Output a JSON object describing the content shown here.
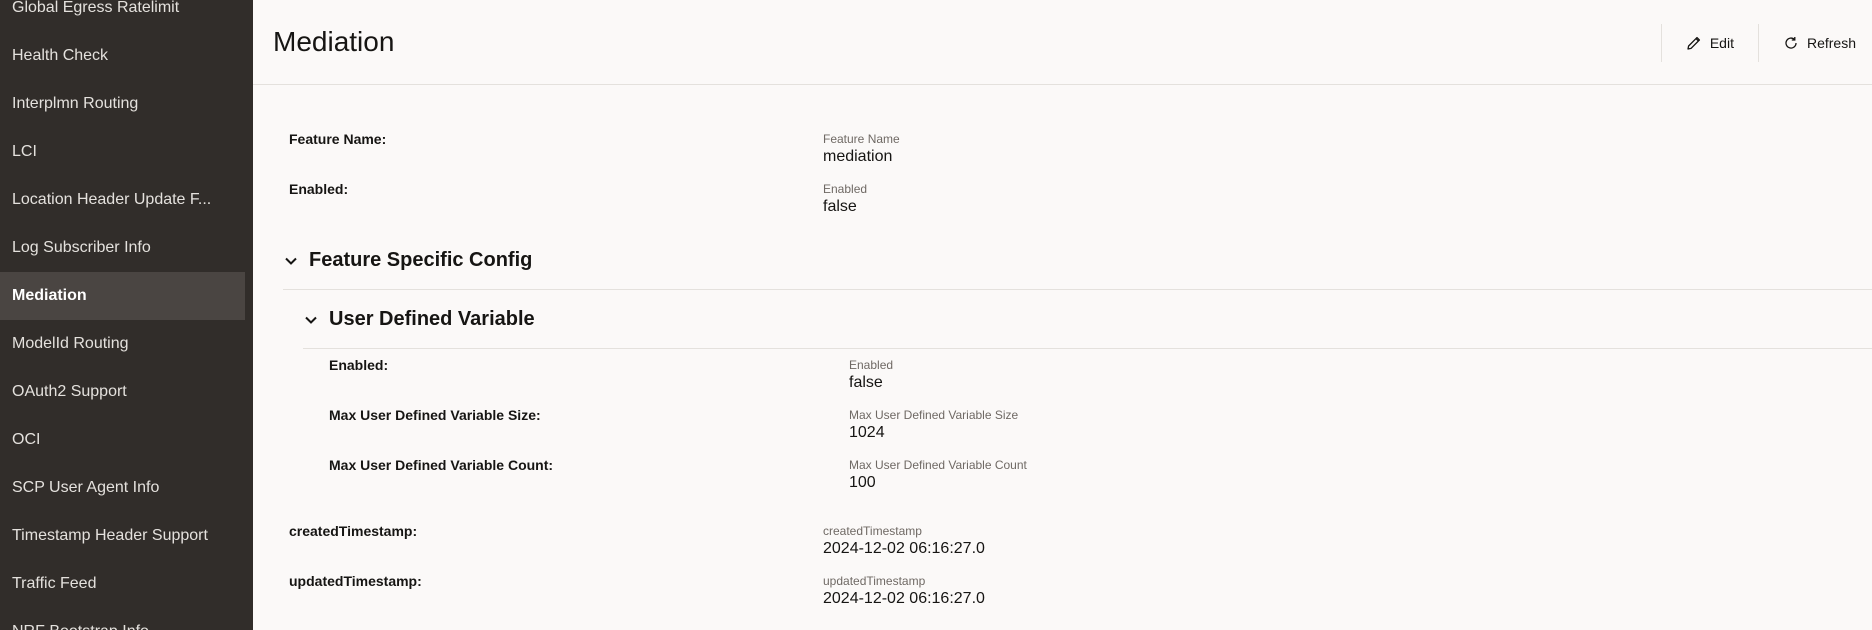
{
  "sidebar": {
    "items": [
      {
        "label": "Global Egress Ratelimit"
      },
      {
        "label": "Health Check"
      },
      {
        "label": "Interplmn Routing"
      },
      {
        "label": "LCI"
      },
      {
        "label": "Location Header Update F..."
      },
      {
        "label": "Log Subscriber Info"
      },
      {
        "label": "Mediation"
      },
      {
        "label": "ModelId Routing"
      },
      {
        "label": "OAuth2 Support"
      },
      {
        "label": "OCI"
      },
      {
        "label": "SCP User Agent Info"
      },
      {
        "label": "Timestamp Header Support"
      },
      {
        "label": "Traffic Feed"
      },
      {
        "label": "NRF Bootstrap Info"
      }
    ]
  },
  "header": {
    "title": "Mediation",
    "edit_label": "Edit",
    "refresh_label": "Refresh"
  },
  "fields": {
    "feature_name": {
      "label": "Feature Name:",
      "caption": "Feature Name",
      "value": "mediation"
    },
    "enabled": {
      "label": "Enabled:",
      "caption": "Enabled",
      "value": "false"
    }
  },
  "feature_specific_config": {
    "title": "Feature Specific Config",
    "user_defined_variable": {
      "title": "User Defined Variable",
      "enabled": {
        "label": "Enabled:",
        "caption": "Enabled",
        "value": "false"
      },
      "max_size": {
        "label": "Max User Defined Variable Size:",
        "caption": "Max User Defined Variable Size",
        "value": "1024"
      },
      "max_count": {
        "label": "Max User Defined Variable Count:",
        "caption": "Max User Defined Variable Count",
        "value": "100"
      }
    }
  },
  "timestamps": {
    "created": {
      "label": "createdTimestamp:",
      "caption": "createdTimestamp",
      "value": "2024-12-02 06:16:27.0"
    },
    "updated": {
      "label": "updatedTimestamp:",
      "caption": "updatedTimestamp",
      "value": "2024-12-02 06:16:27.0"
    }
  }
}
